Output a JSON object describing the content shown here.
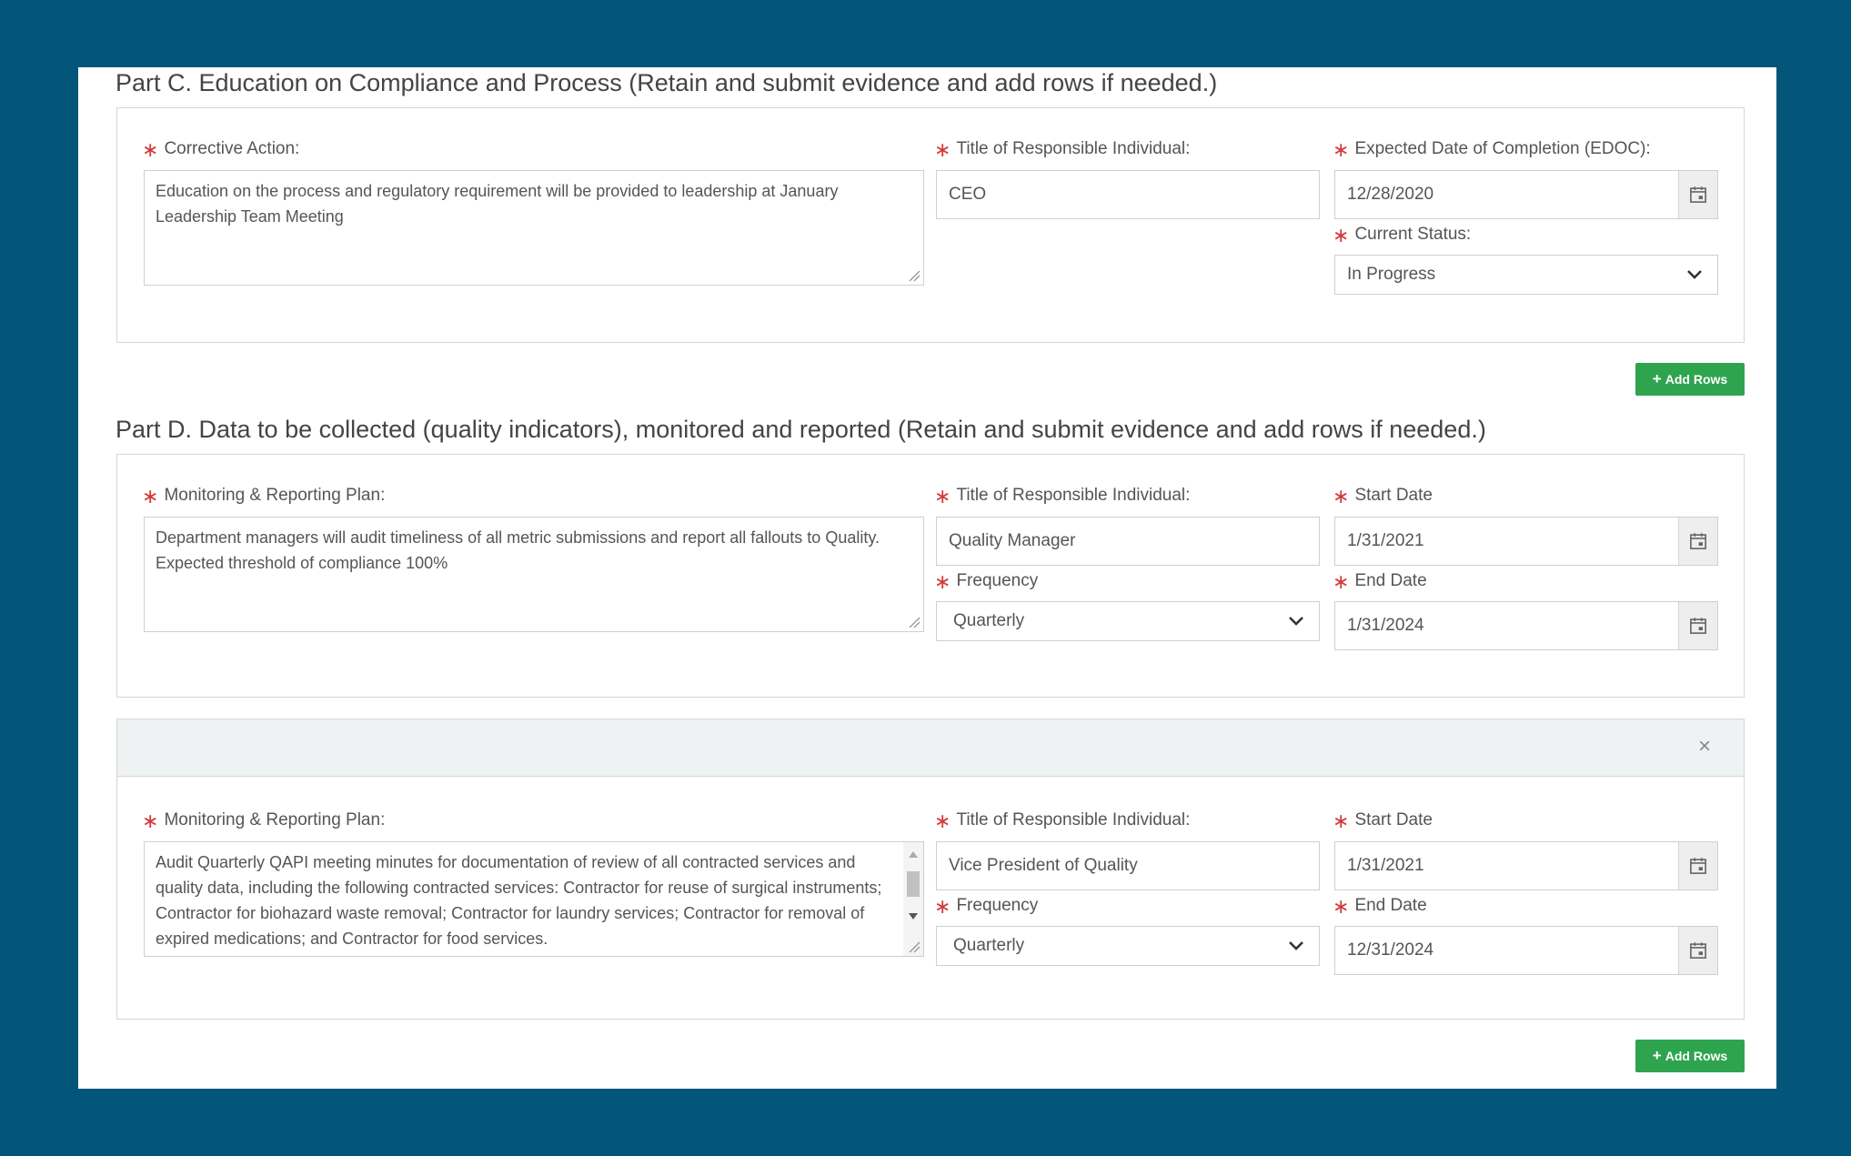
{
  "partC": {
    "title": "Part C. Education on Compliance and Process (Retain and submit evidence and add rows if needed.)",
    "corrective_action_label": "Corrective Action:",
    "corrective_action_value": "Education on the process and regulatory requirement will be provided to leadership at January Leadership Team Meeting",
    "responsible_label": "Title of Responsible Individual:",
    "responsible_value": "CEO",
    "edoc_label": "Expected Date of Completion (EDOC):",
    "edoc_value": "12/28/2020",
    "status_label": "Current Status:",
    "status_value": "In Progress",
    "add_rows_label": "Add Rows"
  },
  "partD": {
    "title": "Part D. Data to be collected (quality indicators), monitored and reported (Retain and submit evidence and add rows if needed.)",
    "rows": [
      {
        "plan_label": "Monitoring & Reporting Plan:",
        "plan_value": "Department managers will audit timeliness of all metric submissions and report all fallouts to Quality. Expected threshold of compliance 100%",
        "responsible_label": "Title of Responsible Individual:",
        "responsible_value": "Quality Manager",
        "frequency_label": "Frequency",
        "frequency_value": "Quarterly",
        "start_label": "Start Date",
        "start_value": "1/31/2021",
        "end_label": "End Date",
        "end_value": "1/31/2024"
      },
      {
        "plan_label": "Monitoring & Reporting Plan:",
        "plan_value": "Audit Quarterly QAPI meeting minutes for documentation of review of all contracted services and quality data, including the following contracted services: Contractor for reuse of surgical instruments; Contractor for biohazard waste removal; Contractor for laundry services; Contractor for removal of expired medications; and Contractor for food services.",
        "responsible_label": "Title of Responsible Individual:",
        "responsible_value": "Vice President of Quality",
        "frequency_label": "Frequency",
        "frequency_value": "Quarterly",
        "start_label": "Start Date",
        "start_value": "1/31/2021",
        "end_label": "End Date",
        "end_value": "12/31/2024"
      }
    ],
    "add_rows_label": "Add Rows",
    "remove_glyph": "×"
  },
  "required_glyph": "∗",
  "colors": {
    "background": "#04557a",
    "required": "#d43a3a",
    "add_button": "#2ea44f"
  },
  "icons": {
    "calendar": "calendar-icon",
    "chevron": "chevron-down-icon",
    "resize": "resize-grip-icon"
  }
}
